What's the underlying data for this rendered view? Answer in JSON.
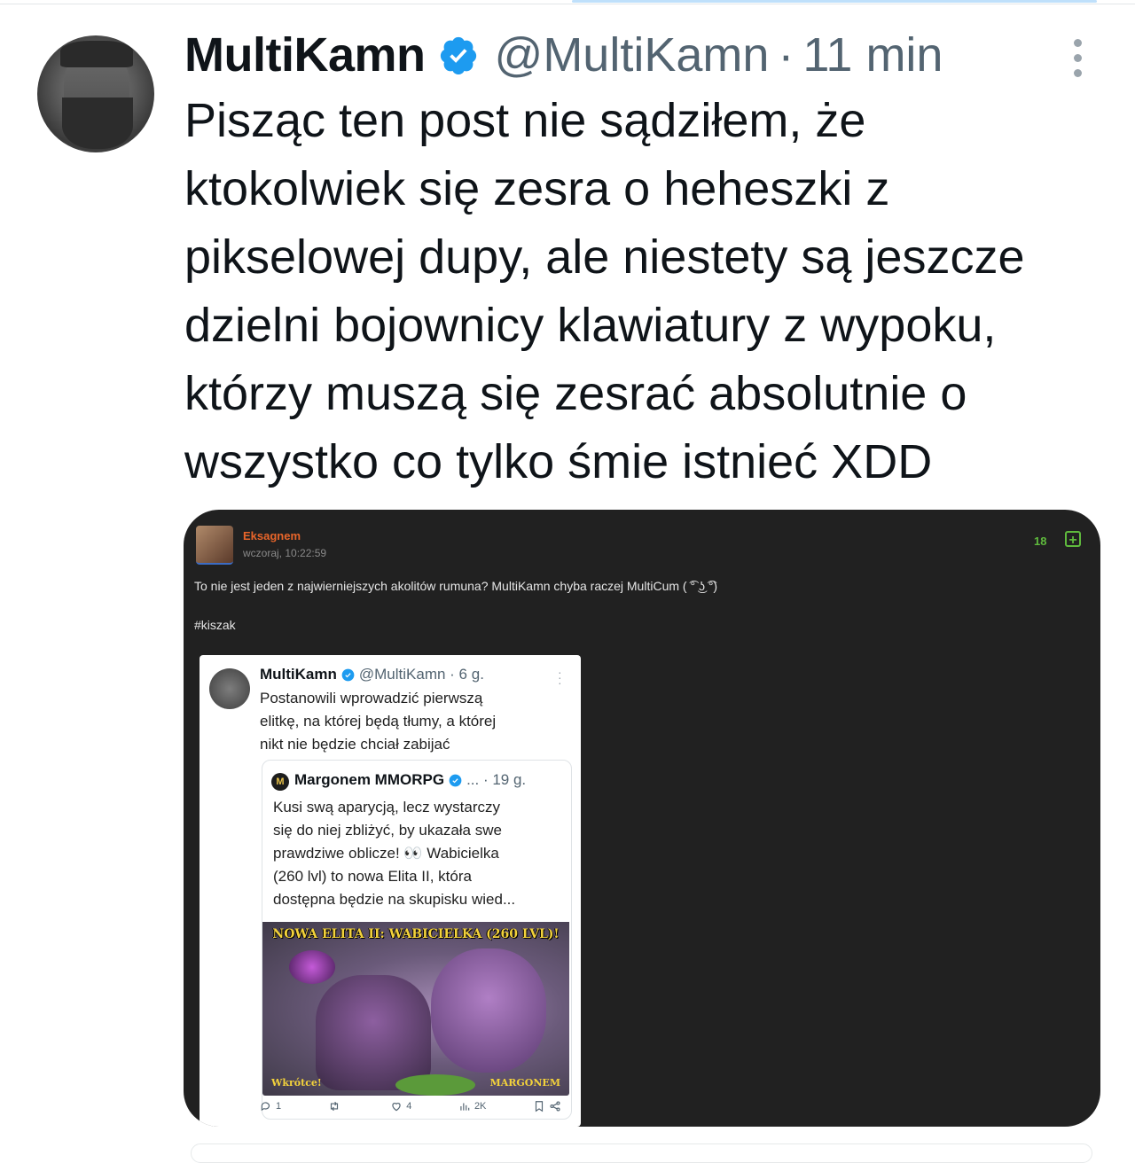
{
  "post": {
    "author_name": "MultiKamn",
    "handle": "@MultiKamn",
    "separator": "·",
    "time": "11 min",
    "text": "Pisząc ten post nie sądziłem, że\nktokolwiek się zesra o heheszki z\npikselowej dupy, ale niestety są jeszcze\ndzielni bojownicy klawiatury z wypoku,\nktórzy muszą się zesrać absolutnie o\nwszystko co tylko śmie istnieć XDD"
  },
  "embed": {
    "username": "Eksagnem",
    "date": "wczoraj, 10:22:59",
    "votes": "18",
    "plus": "+",
    "comment": "To nie jest jeden z najwierniejszych akolitów rumuna? MultiKamn chyba raczej MultiCum ( ͡° ͜ʖ ͡°)",
    "tag": "#kiszak",
    "screenshot": {
      "author_name": "MultiKamn",
      "meta": "@MultiKamn · 6 g.",
      "text": "Postanowili wprowadzić pierwszą\nelitkę, na której będą tłumy, a której\nnikt nie będzie chciał zabijać",
      "quote": {
        "logo": "M",
        "author_name": "Margonem MMORPG",
        "meta": "... · 19 g.",
        "text": "Kusi swą aparycją, lecz wystarczy\nsię do niej zbliżyć, by ukazała swe\nprawdziwe oblicze! 👀 Wabicielka\n(260 lvl) to nowa Elita II, która\ndostępna będzie na skupisku wied...",
        "image_title": "NOWA ELITA II: WABICIELKA (260 LVL)!",
        "image_left": "Wkrótce!",
        "image_right": "MARGONEM"
      },
      "actions": {
        "replies": "1",
        "retweets": "",
        "likes": "4",
        "views": "2K"
      }
    }
  },
  "colors": {
    "verified": "#1d9bf0",
    "embed_bg": "#212121",
    "username": "#e8652a",
    "votes": "#5fba3d"
  }
}
